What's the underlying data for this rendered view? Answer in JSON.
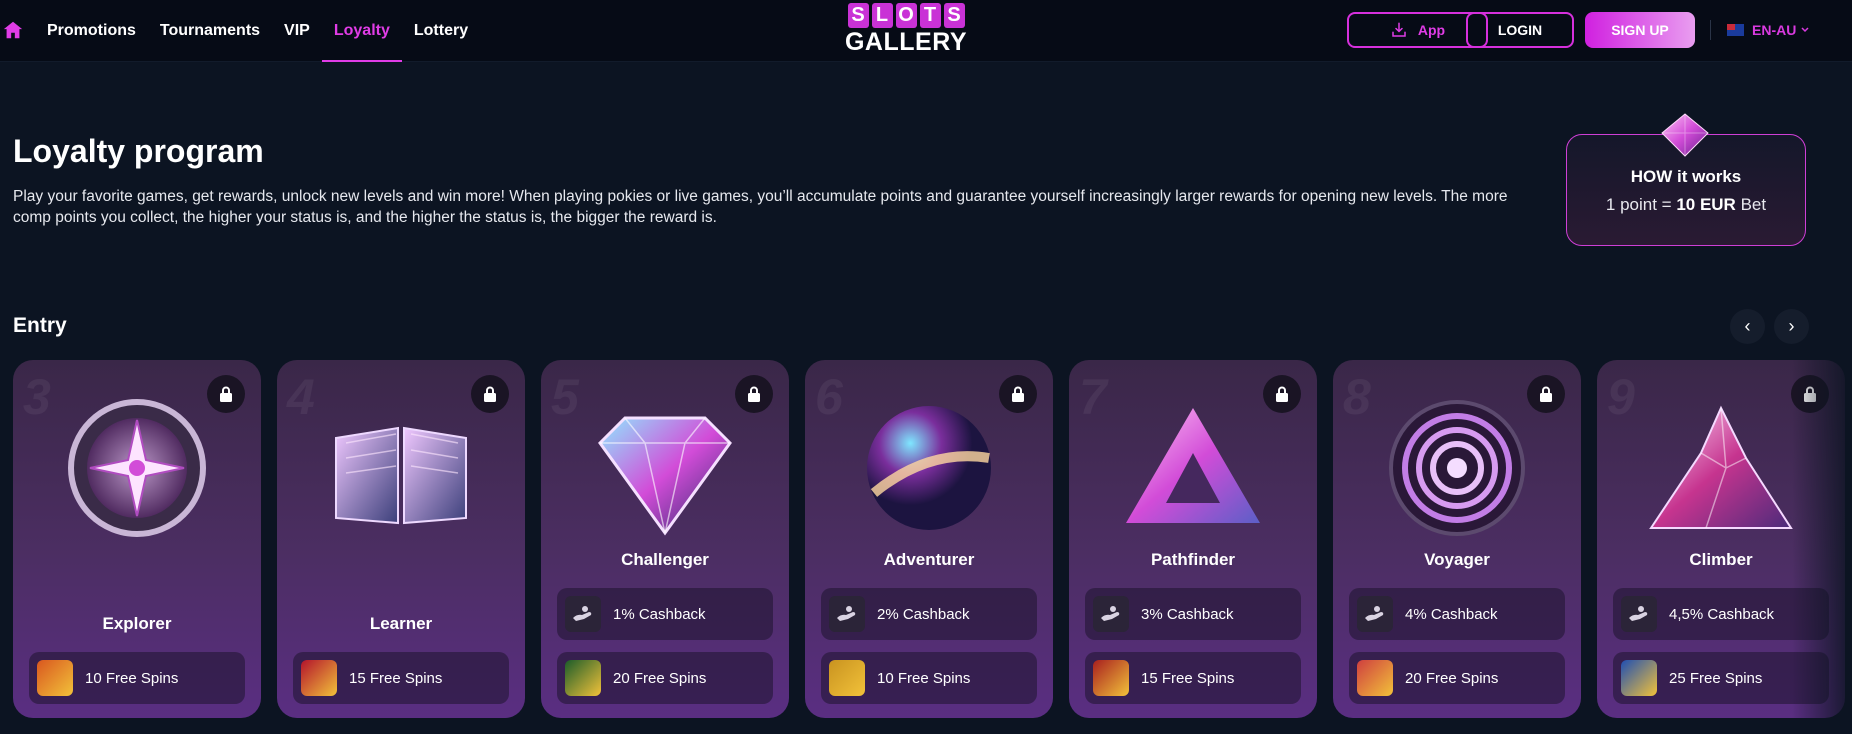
{
  "header": {
    "home_icon": "home-icon",
    "nav": [
      "Promotions",
      "Tournaments",
      "VIP",
      "Loyalty",
      "Lottery"
    ],
    "active_nav": "Loyalty",
    "logo": {
      "top": [
        "S",
        "L",
        "O",
        "T",
        "S"
      ],
      "bottom": "GALLERY"
    },
    "app_label": "App",
    "login_label": "LOGIN",
    "signup_label": "SIGN UP",
    "language": "EN-AU",
    "accent_color": "#e03ce6"
  },
  "hero": {
    "title": "Loyalty program",
    "description": "Play your favorite games, get rewards, unlock new levels and win more! When playing pokies or live games, you’ll accumulate points and guarantee yourself increasingly larger rewards for opening new levels. The more comp points you collect, the higher your status is, and the higher the status is, the bigger the reward is."
  },
  "how_it_works": {
    "title": "HOW it works",
    "line_prefix": "1 point = ",
    "line_value": "10 EUR",
    "line_suffix": " Bet"
  },
  "section": {
    "title": "Entry",
    "prev_icon": "chevron-left-icon",
    "next_icon": "chevron-right-icon"
  },
  "levels": [
    {
      "number": "3",
      "name": "Explorer",
      "cashback": null,
      "spins": "10 Free Spins",
      "art": "compass-icon"
    },
    {
      "number": "4",
      "name": "Learner",
      "cashback": null,
      "spins": "15 Free Spins",
      "art": "book-icon"
    },
    {
      "number": "5",
      "name": "Challenger",
      "cashback": "1% Cashback",
      "spins": "20 Free Spins",
      "art": "diamond-icon"
    },
    {
      "number": "6",
      "name": "Adventurer",
      "cashback": "2% Cashback",
      "spins": "10 Free Spins",
      "art": "sphere-icon"
    },
    {
      "number": "7",
      "name": "Pathfinder",
      "cashback": "3% Cashback",
      "spins": "15 Free Spins",
      "art": "triangle-icon"
    },
    {
      "number": "8",
      "name": "Voyager",
      "cashback": "4% Cashback",
      "spins": "20 Free Spins",
      "art": "vortex-icon"
    },
    {
      "number": "9",
      "name": "Climber",
      "cashback": "4,5% Cashback",
      "spins": "25 Free Spins",
      "art": "mountain-icon"
    }
  ]
}
